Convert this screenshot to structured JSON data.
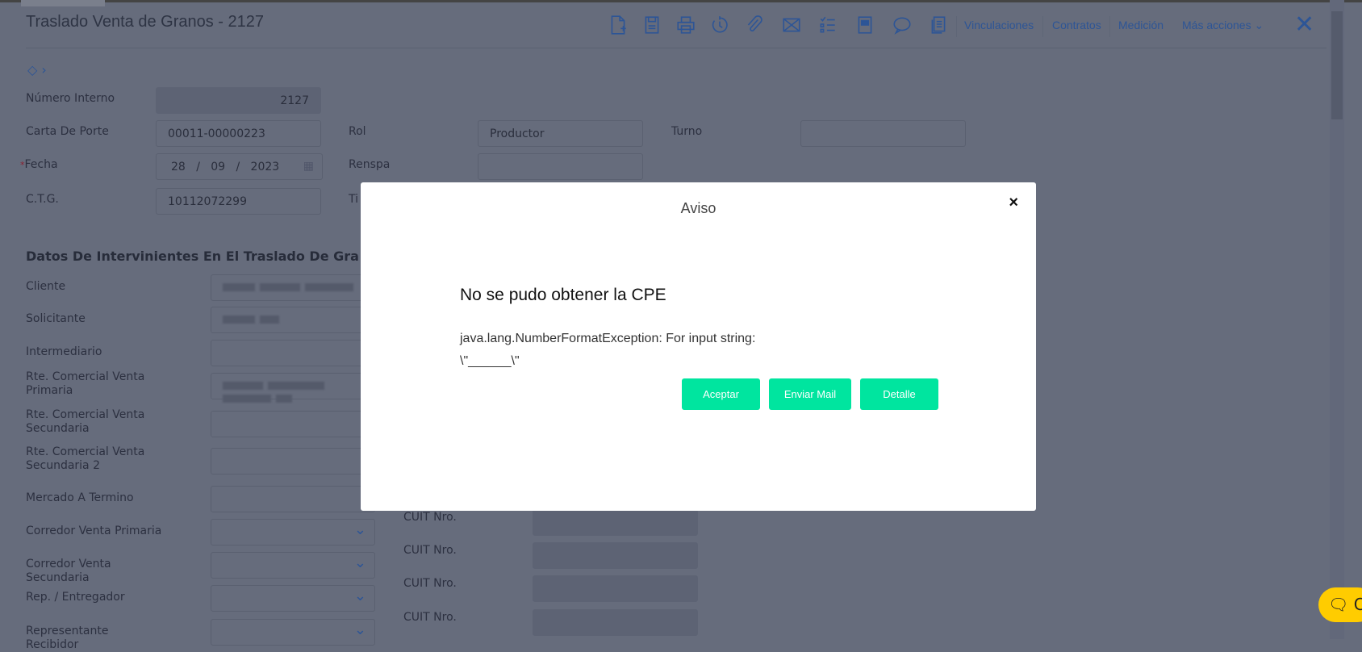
{
  "header": {
    "title": "Traslado Venta de Granos - 2127",
    "links": [
      "Vinculaciones",
      "Contratos",
      "Medición"
    ],
    "more_actions": "Más acciones"
  },
  "form": {
    "numero_interno": {
      "label": "Número Interno",
      "value": "2127"
    },
    "carta_de_porte": {
      "label": "Carta De Porte",
      "value": "00011-00000223"
    },
    "fecha": {
      "label": "Fecha",
      "required_mark": "*",
      "day": "28",
      "month": "09",
      "year": "2023",
      "sep": "/"
    },
    "ctg": {
      "label": "C.T.G.",
      "value": "10112072299"
    },
    "rol": {
      "label": "Rol",
      "value": "Productor"
    },
    "turno": {
      "label": "Turno",
      "value": ""
    },
    "renspa": {
      "label": "Renspa",
      "value": ""
    },
    "tipo": {
      "label": "Ti"
    }
  },
  "section": {
    "title": "Datos De Intervinientes En El Traslado De Gra",
    "fields": [
      "Cliente",
      "Solicitante",
      "Intermediario",
      "Rte. Comercial Venta Primaria",
      "Rte. Comercial Venta Secundaria",
      "Rte. Comercial Venta Secundaria 2",
      "Mercado A Termino",
      "Corredor Venta Primaria",
      "Corredor Venta Secundaria",
      "Rep. / Entregador",
      "Representante Recibidor"
    ],
    "cuit_label": "CUIT Nro."
  },
  "modal": {
    "title": "Aviso",
    "close": "×",
    "heading": "No se pudo obtener la CPE",
    "message": "java.lang.NumberFormatException: For input string: \\\"______\\\"",
    "buttons": {
      "accept": "Aceptar",
      "mail": "Enviar Mail",
      "detail": "Detalle"
    }
  },
  "chat": {
    "label": "C"
  },
  "colors": {
    "accent": "#2a6bc0",
    "button": "#00e59f",
    "chat": "#ffcc00"
  }
}
